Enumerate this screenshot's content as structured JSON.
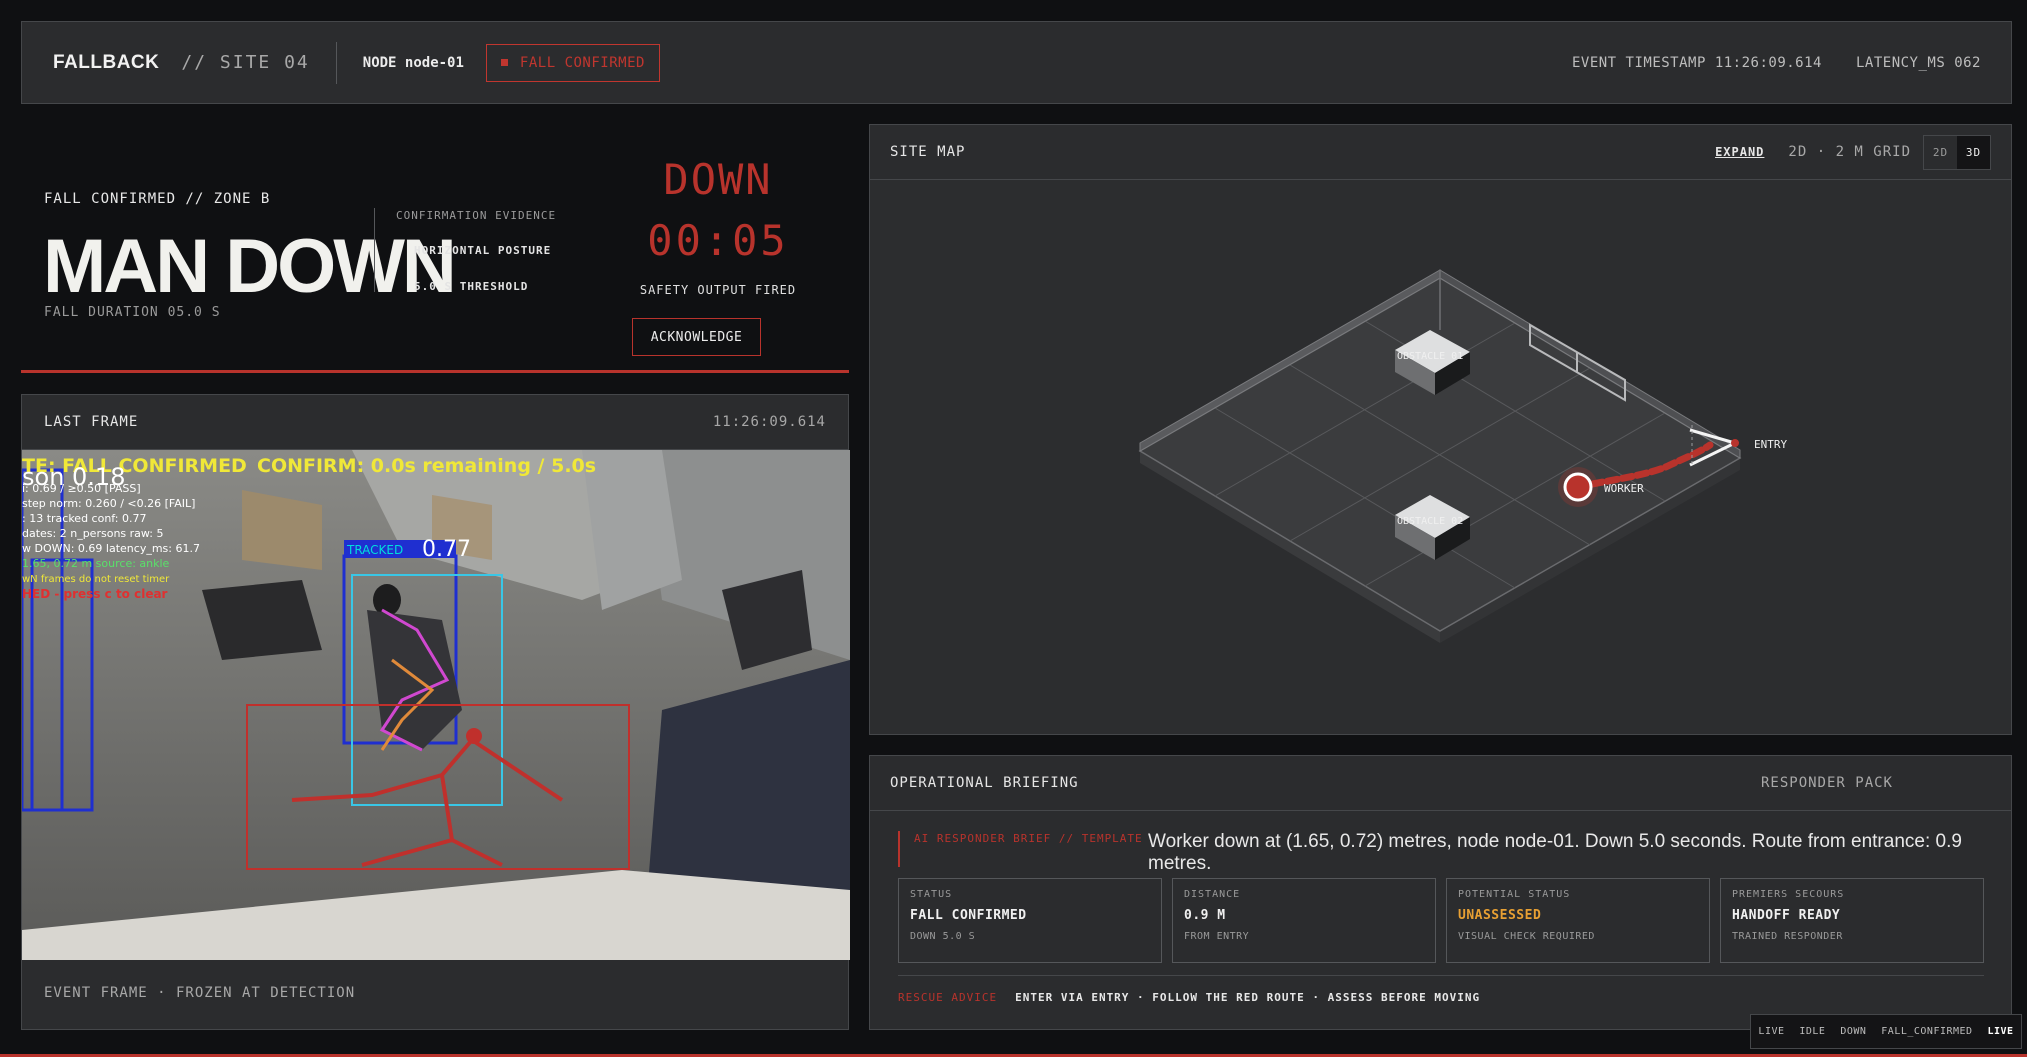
{
  "header": {
    "brand": "FALLBACK",
    "site": "// SITE 04",
    "node": "NODE node-01",
    "status_badge": "FALL CONFIRMED",
    "event_timestamp": "EVENT TIMESTAMP 11:26:09.614",
    "latency": "LATENCY_MS 062"
  },
  "alert": {
    "zone": "FALL CONFIRMED // ZONE B",
    "title": "MAN DOWN",
    "duration": "FALL DURATION 05.0 S",
    "evidence_heading": "CONFIRMATION EVIDENCE",
    "evidence_1": "HORIZONTAL POSTURE",
    "evidence_2": "5.0 S THRESHOLD",
    "down_label": "DOWN",
    "timer": "00:05",
    "safety": "SAFETY OUTPUT FIRED",
    "ack_label": "ACKNOWLEDGE"
  },
  "frame": {
    "title": "LAST FRAME",
    "timestamp": "11:26:09.614",
    "footer": "EVENT FRAME · FROZEN AT DETECTION",
    "overlay": {
      "state_line": "TE: FALL CONFIRMED",
      "confirm_line": "CONFIRM: 0.0s remaining / 5.0s",
      "big_label": "son 0.18",
      "line1": "i: 0.69 / ≥0.50 [PASS]",
      "line2": "step norm: 0.260 / <0.26 [FAIL]",
      "line3": ": 13   tracked conf: 0.77",
      "line4": "dates: 2   n_persons raw: 5",
      "line5": "w DOWN: 0.69   latency_ms: 61.7",
      "line6": "1.65, 0.72 m   source: ankle",
      "line7": "wN frames do not reset timer",
      "line8": "HED - press c to clear",
      "track_label": "TRACKED",
      "track_conf": "0.77"
    }
  },
  "map": {
    "title": "SITE MAP",
    "expand": "EXPAND",
    "grid": "2D · 2 M GRID",
    "toggle_2d": "2D",
    "toggle_3d": "3D",
    "obstacle_1": "OBSTACLE 01",
    "obstacle_2": "OBSTACLE 02",
    "worker": "WORKER",
    "entry": "ENTRY"
  },
  "briefing": {
    "title": "OPERATIONAL BRIEFING",
    "pack": "RESPONDER PACK",
    "ai_tag": "AI RESPONDER BRIEF // TEMPLATE",
    "ai_text": "Worker down at (1.65, 0.72) metres, node node-01. Down 5.0 seconds. Route from entrance: 0.9 metres.",
    "cards": [
      {
        "key": "STATUS",
        "value": "FALL CONFIRMED",
        "sub": "DOWN 5.0 S"
      },
      {
        "key": "DISTANCE",
        "value": "0.9 M",
        "sub": "FROM ENTRY"
      },
      {
        "key": "POTENTIAL STATUS",
        "value": "UNASSESSED",
        "sub": "VISUAL CHECK REQUIRED"
      },
      {
        "key": "PREMIERS SECOURS",
        "value": "HANDOFF READY",
        "sub": "TRAINED RESPONDER"
      }
    ],
    "advice_key": "RESCUE ADVICE",
    "advice_text": "ENTER VIA ENTRY · FOLLOW THE RED ROUTE · ASSESS BEFORE MOVING"
  },
  "statebar": {
    "items": [
      "LIVE",
      "IDLE",
      "DOWN",
      "FALL_CONFIRMED",
      "LIVE"
    ]
  },
  "colors": {
    "accent_red": "#b8332c",
    "amber": "#e8a033",
    "panel": "#2b2c2e",
    "background": "#0f1012"
  }
}
